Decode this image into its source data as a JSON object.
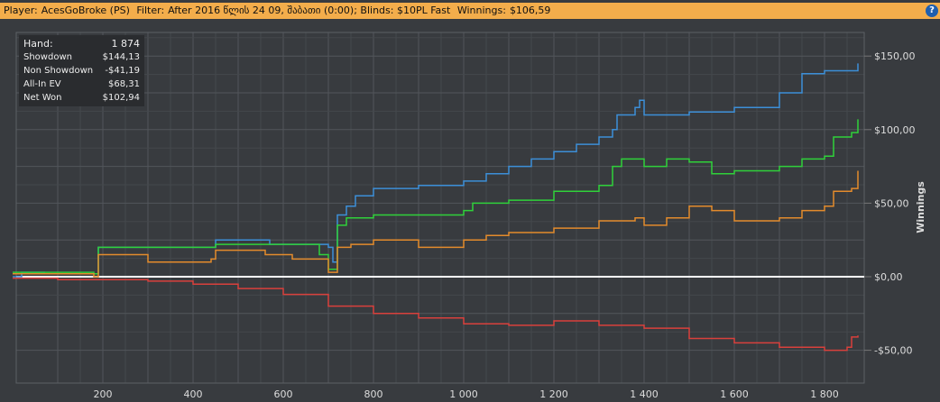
{
  "header": {
    "player_label": "Player:",
    "player": "AcesGoBroke (PS)",
    "filter_label": "Filter:",
    "filter": "After 2016 წლის 24 09, შაბათი (0:00); Blinds: $10PL Fast",
    "winnings_label": "Winnings:",
    "winnings": "$106,59",
    "help_icon": "?"
  },
  "stats": [
    {
      "label": "Hand:",
      "value": "1 874"
    },
    {
      "label": "Showdown",
      "value": "$144,13"
    },
    {
      "label": "Non Showdown",
      "value": "-$41,19"
    },
    {
      "label": "All-In EV",
      "value": "$68,31"
    },
    {
      "label": "Net Won",
      "value": "$102,94"
    }
  ],
  "chart_data": {
    "type": "line",
    "ylabel": "Winnings",
    "xlim": [
      0,
      1900
    ],
    "ylim": [
      -62,
      168
    ],
    "xticks": [
      200,
      400,
      600,
      800,
      1000,
      1200,
      1400,
      1600,
      1800
    ],
    "xtick_labels": [
      "200",
      "400",
      "600",
      "800",
      "1 000",
      "1 200",
      "1 400",
      "1 600",
      "1 800"
    ],
    "yticks": [
      150,
      100,
      50,
      0,
      -50
    ],
    "ytick_labels": [
      "$150,00",
      "$100,00",
      "$50,00",
      "$0,00",
      "-$50,00"
    ],
    "series": [
      {
        "name": "Showdown",
        "color": "#3c8fd8",
        "points": [
          [
            0,
            0
          ],
          [
            20,
            3
          ],
          [
            60,
            3
          ],
          [
            70,
            2
          ],
          [
            180,
            2
          ],
          [
            190,
            20
          ],
          [
            440,
            20
          ],
          [
            450,
            25
          ],
          [
            560,
            25
          ],
          [
            570,
            22
          ],
          [
            700,
            20
          ],
          [
            710,
            10
          ],
          [
            720,
            42
          ],
          [
            740,
            48
          ],
          [
            760,
            55
          ],
          [
            800,
            60
          ],
          [
            900,
            62
          ],
          [
            1000,
            65
          ],
          [
            1050,
            70
          ],
          [
            1100,
            75
          ],
          [
            1150,
            80
          ],
          [
            1200,
            85
          ],
          [
            1250,
            90
          ],
          [
            1300,
            95
          ],
          [
            1330,
            100
          ],
          [
            1340,
            110
          ],
          [
            1380,
            115
          ],
          [
            1390,
            120
          ],
          [
            1400,
            110
          ],
          [
            1500,
            112
          ],
          [
            1600,
            115
          ],
          [
            1700,
            125
          ],
          [
            1750,
            138
          ],
          [
            1800,
            140
          ],
          [
            1874,
            145
          ]
        ]
      },
      {
        "name": "Net Won",
        "color": "#2fd13a",
        "points": [
          [
            0,
            3
          ],
          [
            180,
            2
          ],
          [
            190,
            20
          ],
          [
            440,
            20
          ],
          [
            450,
            22
          ],
          [
            620,
            22
          ],
          [
            680,
            15
          ],
          [
            700,
            5
          ],
          [
            720,
            35
          ],
          [
            740,
            40
          ],
          [
            800,
            42
          ],
          [
            900,
            42
          ],
          [
            1000,
            45
          ],
          [
            1020,
            50
          ],
          [
            1100,
            52
          ],
          [
            1200,
            58
          ],
          [
            1300,
            62
          ],
          [
            1330,
            75
          ],
          [
            1350,
            80
          ],
          [
            1400,
            75
          ],
          [
            1450,
            80
          ],
          [
            1500,
            78
          ],
          [
            1550,
            70
          ],
          [
            1600,
            72
          ],
          [
            1700,
            75
          ],
          [
            1750,
            80
          ],
          [
            1800,
            82
          ],
          [
            1820,
            95
          ],
          [
            1860,
            98
          ],
          [
            1874,
            107
          ]
        ]
      },
      {
        "name": "All-In EV",
        "color": "#e38b2c",
        "points": [
          [
            0,
            2
          ],
          [
            180,
            0
          ],
          [
            190,
            15
          ],
          [
            300,
            10
          ],
          [
            440,
            12
          ],
          [
            450,
            18
          ],
          [
            560,
            15
          ],
          [
            620,
            12
          ],
          [
            700,
            3
          ],
          [
            720,
            20
          ],
          [
            750,
            22
          ],
          [
            800,
            25
          ],
          [
            900,
            20
          ],
          [
            1000,
            25
          ],
          [
            1050,
            28
          ],
          [
            1100,
            30
          ],
          [
            1200,
            33
          ],
          [
            1300,
            38
          ],
          [
            1380,
            40
          ],
          [
            1400,
            35
          ],
          [
            1450,
            40
          ],
          [
            1500,
            48
          ],
          [
            1550,
            45
          ],
          [
            1600,
            38
          ],
          [
            1700,
            40
          ],
          [
            1750,
            45
          ],
          [
            1800,
            48
          ],
          [
            1820,
            58
          ],
          [
            1860,
            60
          ],
          [
            1874,
            72
          ]
        ]
      },
      {
        "name": "Non Showdown",
        "color": "#d9403c",
        "points": [
          [
            0,
            -1
          ],
          [
            100,
            -2
          ],
          [
            200,
            -2
          ],
          [
            300,
            -3
          ],
          [
            400,
            -5
          ],
          [
            500,
            -8
          ],
          [
            600,
            -12
          ],
          [
            700,
            -20
          ],
          [
            800,
            -25
          ],
          [
            900,
            -28
          ],
          [
            1000,
            -32
          ],
          [
            1100,
            -33
          ],
          [
            1200,
            -30
          ],
          [
            1300,
            -33
          ],
          [
            1400,
            -35
          ],
          [
            1500,
            -42
          ],
          [
            1600,
            -45
          ],
          [
            1700,
            -48
          ],
          [
            1800,
            -50
          ],
          [
            1850,
            -48
          ],
          [
            1860,
            -41
          ],
          [
            1874,
            -40
          ]
        ]
      }
    ]
  }
}
